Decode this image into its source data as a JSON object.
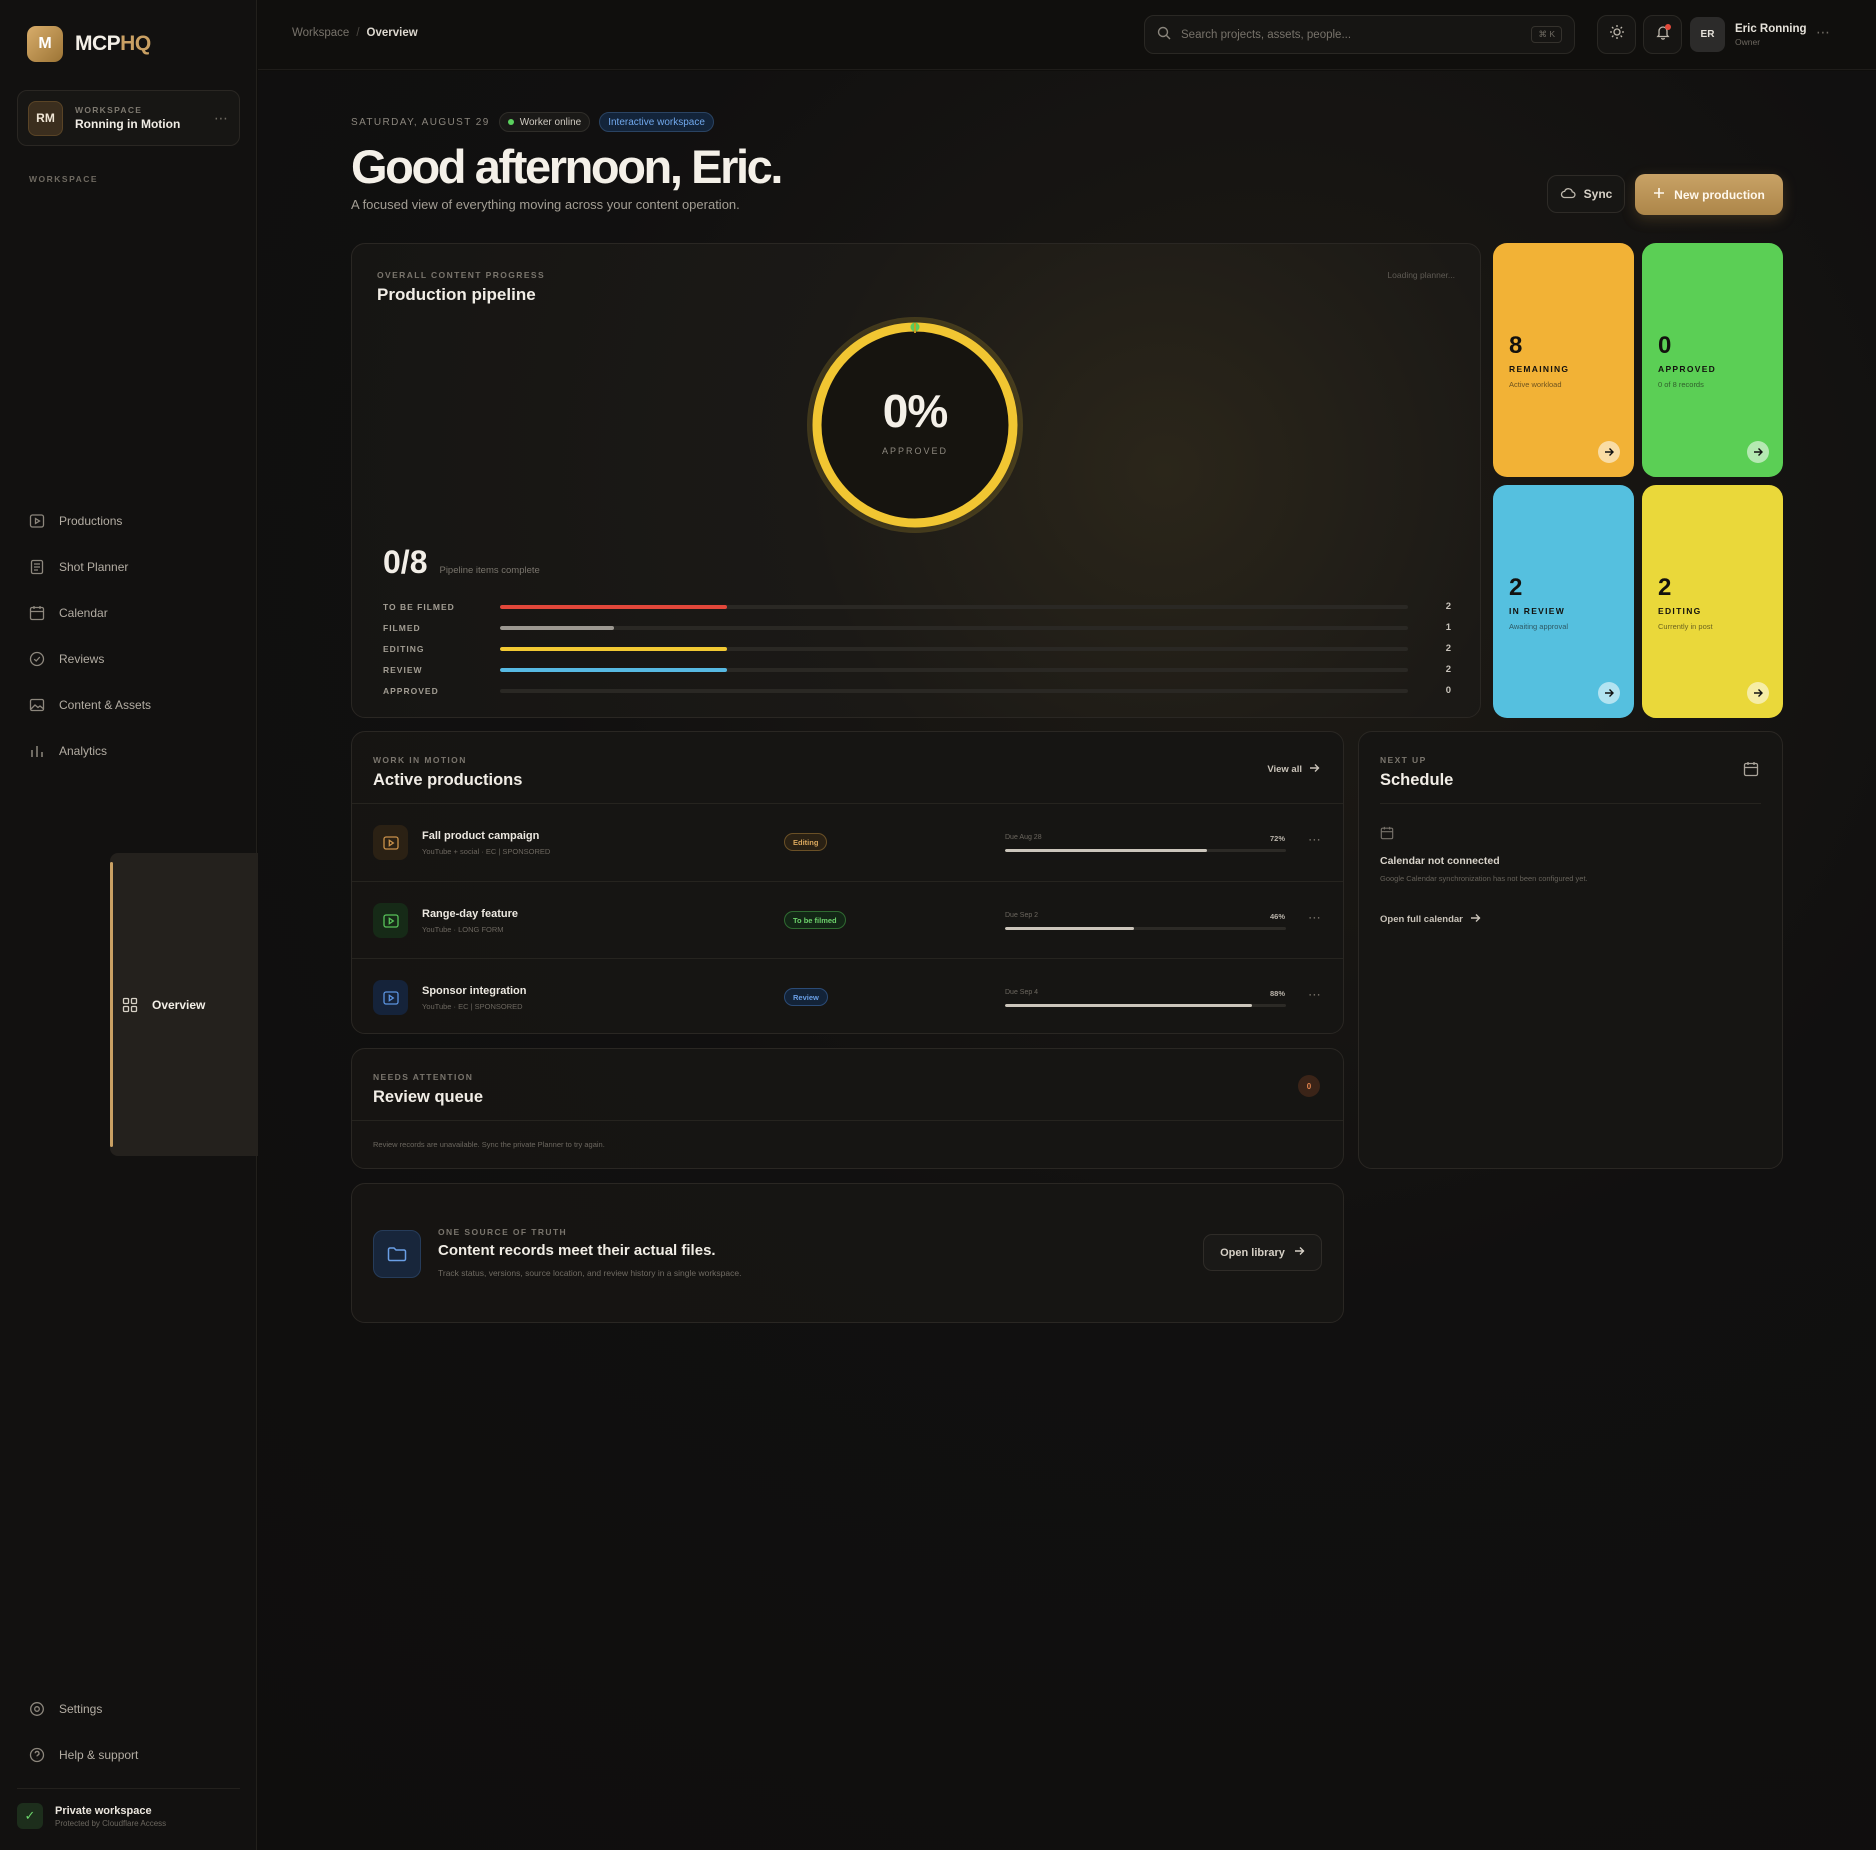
{
  "brand": {
    "mark": "M",
    "name_main": "MCP",
    "name_accent": "HQ"
  },
  "workspace_card": {
    "initials": "RM",
    "kicker": "WORKSPACE",
    "name": "Ronning in Motion"
  },
  "nav": {
    "heading": "WORKSPACE",
    "items": [
      {
        "label": "Overview",
        "icon": "grid-icon",
        "active": true
      },
      {
        "label": "Productions",
        "icon": "play-icon"
      },
      {
        "label": "Shot Planner",
        "icon": "clipboard-icon"
      },
      {
        "label": "Calendar",
        "icon": "calendar-icon"
      },
      {
        "label": "Reviews",
        "icon": "check-circle-icon"
      },
      {
        "label": "Content & Assets",
        "icon": "image-icon"
      },
      {
        "label": "Analytics",
        "icon": "bar-chart-icon"
      }
    ],
    "bottom": [
      {
        "label": "Settings",
        "icon": "gear-icon"
      },
      {
        "label": "Help & support",
        "icon": "help-icon"
      }
    ]
  },
  "private": {
    "title": "Private workspace",
    "sub": "Protected by Cloudflare Access"
  },
  "topbar": {
    "crumb_root": "Workspace",
    "crumb_sep": "/",
    "crumb_current": "Overview",
    "search_placeholder": "Search projects, assets, people...",
    "search_kbd": "⌘ K",
    "user_initials": "ER",
    "user_name": "Eric Ronning",
    "user_role": "Owner"
  },
  "hero": {
    "date": "SATURDAY, AUGUST 29",
    "worker_status": "Worker online",
    "workspace_mode": "Interactive workspace",
    "greeting": "Good afternoon, Eric.",
    "lede": "A focused view of everything moving across your content operation.",
    "sync_label": "Sync",
    "new_label": "New production"
  },
  "pipeline": {
    "kicker": "OVERALL CONTENT PROGRESS",
    "title": "Production pipeline",
    "loading": "Loading planner...",
    "percent_label": "0%",
    "approved_fraction": 0,
    "approved_label": "APPROVED",
    "count": "0/8",
    "count_sub": "Pipeline items complete",
    "total": 8,
    "stages": [
      {
        "label": "TO BE FILMED",
        "value": 2,
        "color": "#e2473a"
      },
      {
        "label": "FILMED",
        "value": 1,
        "color": "#9c9891"
      },
      {
        "label": "EDITING",
        "value": 2,
        "color": "#f2c933"
      },
      {
        "label": "REVIEW",
        "value": 2,
        "color": "#57b9e2"
      },
      {
        "label": "APPROVED",
        "value": 0,
        "color": "#5ccc5b"
      }
    ]
  },
  "stats": [
    {
      "num": "8",
      "label": "REMAINING",
      "sub": "Active workload",
      "color": "#f2b236"
    },
    {
      "num": "0",
      "label": "APPROVED",
      "sub": "0 of 8 records",
      "color": "#5bcf55"
    },
    {
      "num": "2",
      "label": "IN REVIEW",
      "sub": "Awaiting approval",
      "color": "#55c0df"
    },
    {
      "num": "2",
      "label": "EDITING",
      "sub": "Currently in post",
      "color": "#ead83a"
    }
  ],
  "active": {
    "kicker": "WORK IN MOTION",
    "title": "Active productions",
    "view_all": "View all",
    "rows": [
      {
        "title": "Fall product campaign",
        "sub": "YouTube + social · EC | SPONSORED",
        "status": "Editing",
        "due": "Due Aug 28",
        "pct": "72%",
        "progress": 0.72,
        "icon_bg": "#2b2114",
        "icon_color": "#c9914a",
        "status_bg": "#2a2114",
        "status_border": "#6a5026",
        "status_color": "#d9a75d"
      },
      {
        "title": "Range-day feature",
        "sub": "YouTube · LONG FORM",
        "status": "To be filmed",
        "due": "Due Sep 2",
        "pct": "46%",
        "progress": 0.46,
        "icon_bg": "#162a17",
        "icon_color": "#58c25a",
        "status_bg": "#132616",
        "status_border": "#2f6a31",
        "status_color": "#6dd26c"
      },
      {
        "title": "Sponsor integration",
        "sub": "YouTube · EC | SPONSORED",
        "status": "Review",
        "due": "Due Sep 4",
        "pct": "88%",
        "progress": 0.88,
        "icon_bg": "#15233a",
        "icon_color": "#5c94e0",
        "status_bg": "#132338",
        "status_border": "#2b4b76",
        "status_color": "#6a9fe6"
      }
    ]
  },
  "review": {
    "kicker": "NEEDS ATTENTION",
    "title": "Review queue",
    "count": "0",
    "note": "Review records are unavailable. Sync the private Planner to try again."
  },
  "library": {
    "kicker": "ONE SOURCE OF TRUTH",
    "title": "Content records meet their actual files.",
    "sub": "Track status, versions, source location, and review history in a single workspace.",
    "button": "Open library"
  },
  "schedule": {
    "kicker": "NEXT UP",
    "title": "Schedule",
    "status_title": "Calendar not connected",
    "status_sub": "Google Calendar synchronization has not been configured yet.",
    "link": "Open full calendar"
  }
}
